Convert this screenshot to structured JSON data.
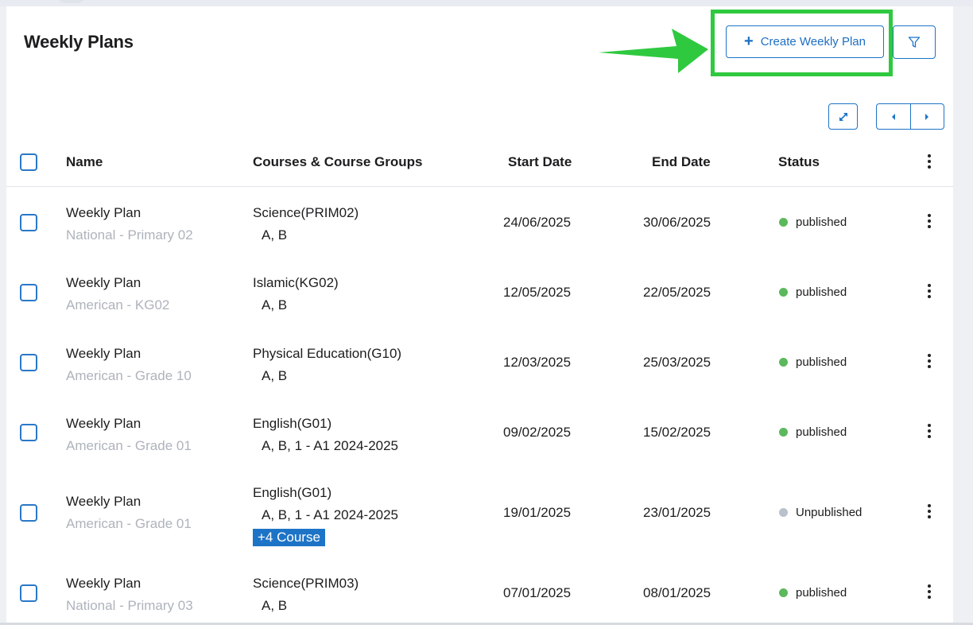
{
  "page": {
    "title": "Weekly Plans"
  },
  "toolbar": {
    "create_label": "Create Weekly Plan"
  },
  "icons": {
    "plus": "plus-icon",
    "filter": "filter-icon",
    "expand": "expand-icon",
    "prev": "caret-left-icon",
    "next": "caret-right-icon",
    "menu": "kebab-menu-icon"
  },
  "colors": {
    "accent": "#1d74c7",
    "highlight": "#2fc93f",
    "published": "#5cb85c",
    "unpublished": "#b9c2cc"
  },
  "table": {
    "headers": {
      "name": "Name",
      "courses": "Courses & Course Groups",
      "start": "Start Date",
      "end": "End Date",
      "status": "Status"
    },
    "rows": [
      {
        "name": "Weekly Plan",
        "sub": "National - Primary 02",
        "course": "Science(PRIM02)",
        "groups": "A, B",
        "more": "",
        "start": "24/06/2025",
        "end": "30/06/2025",
        "status": "published"
      },
      {
        "name": "Weekly Plan",
        "sub": "American - KG02",
        "course": "Islamic(KG02)",
        "groups": "A, B",
        "more": "",
        "start": "12/05/2025",
        "end": "22/05/2025",
        "status": "published"
      },
      {
        "name": "Weekly Plan",
        "sub": "American - Grade 10",
        "course": "Physical Education(G10)",
        "groups": "A, B",
        "more": "",
        "start": "12/03/2025",
        "end": "25/03/2025",
        "status": "published"
      },
      {
        "name": "Weekly Plan",
        "sub": "American - Grade 01",
        "course": "English(G01)",
        "groups": "A, B, 1 - A1 2024-2025",
        "more": "",
        "start": "09/02/2025",
        "end": "15/02/2025",
        "status": "published"
      },
      {
        "name": "Weekly Plan",
        "sub": "American - Grade 01",
        "course": "English(G01)",
        "groups": "A, B, 1 - A1 2024-2025",
        "more": "+4 Course",
        "start": "19/01/2025",
        "end": "23/01/2025",
        "status": "Unpublished"
      },
      {
        "name": "Weekly Plan",
        "sub": "National - Primary 03",
        "course": "Science(PRIM03)",
        "groups": "A, B",
        "more": "",
        "start": "07/01/2025",
        "end": "08/01/2025",
        "status": "published"
      }
    ]
  }
}
